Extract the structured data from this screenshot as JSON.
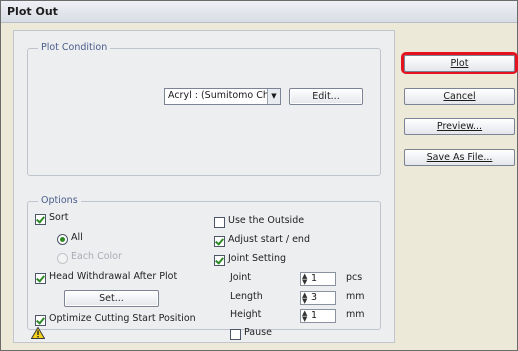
{
  "window": {
    "title": "Plot Out"
  },
  "plot_condition": {
    "legend": "Plot Condition",
    "material_select": "Acryl : (Sumitomo Ch...",
    "edit_button": "Edit..."
  },
  "options": {
    "legend": "Options",
    "sort": {
      "label": "Sort",
      "checked": true
    },
    "radio_all": {
      "label": "All",
      "selected": true
    },
    "radio_each_color": {
      "label": "Each Color",
      "enabled": false
    },
    "head_withdrawal": {
      "label": "Head Withdrawal After Plot",
      "checked": true
    },
    "set_button": "Set...",
    "optimize": {
      "label": "Optimize Cutting Start Position",
      "checked": true
    },
    "use_outside": {
      "label": "Use the Outside",
      "checked": false
    },
    "adjust": {
      "label": "Adjust start / end",
      "checked": true
    },
    "joint_setting": {
      "label": "Joint Setting",
      "checked": true
    },
    "joint": {
      "label": "Joint",
      "value": "1",
      "unit": "pcs"
    },
    "length": {
      "label": "Length",
      "value": "3",
      "unit": "mm"
    },
    "height": {
      "label": "Height",
      "value": "1",
      "unit": "mm"
    },
    "pause": {
      "label": "Pause",
      "checked": false
    }
  },
  "buttons": {
    "plot": "Plot",
    "cancel": "Cancel",
    "preview": "Preview...",
    "save_as": "Save As File..."
  },
  "colors": {
    "highlight": "#e4131f",
    "check": "#2e8a25",
    "legend_text": "#4a5c8a"
  },
  "icons": {
    "warning": "warning-icon"
  }
}
